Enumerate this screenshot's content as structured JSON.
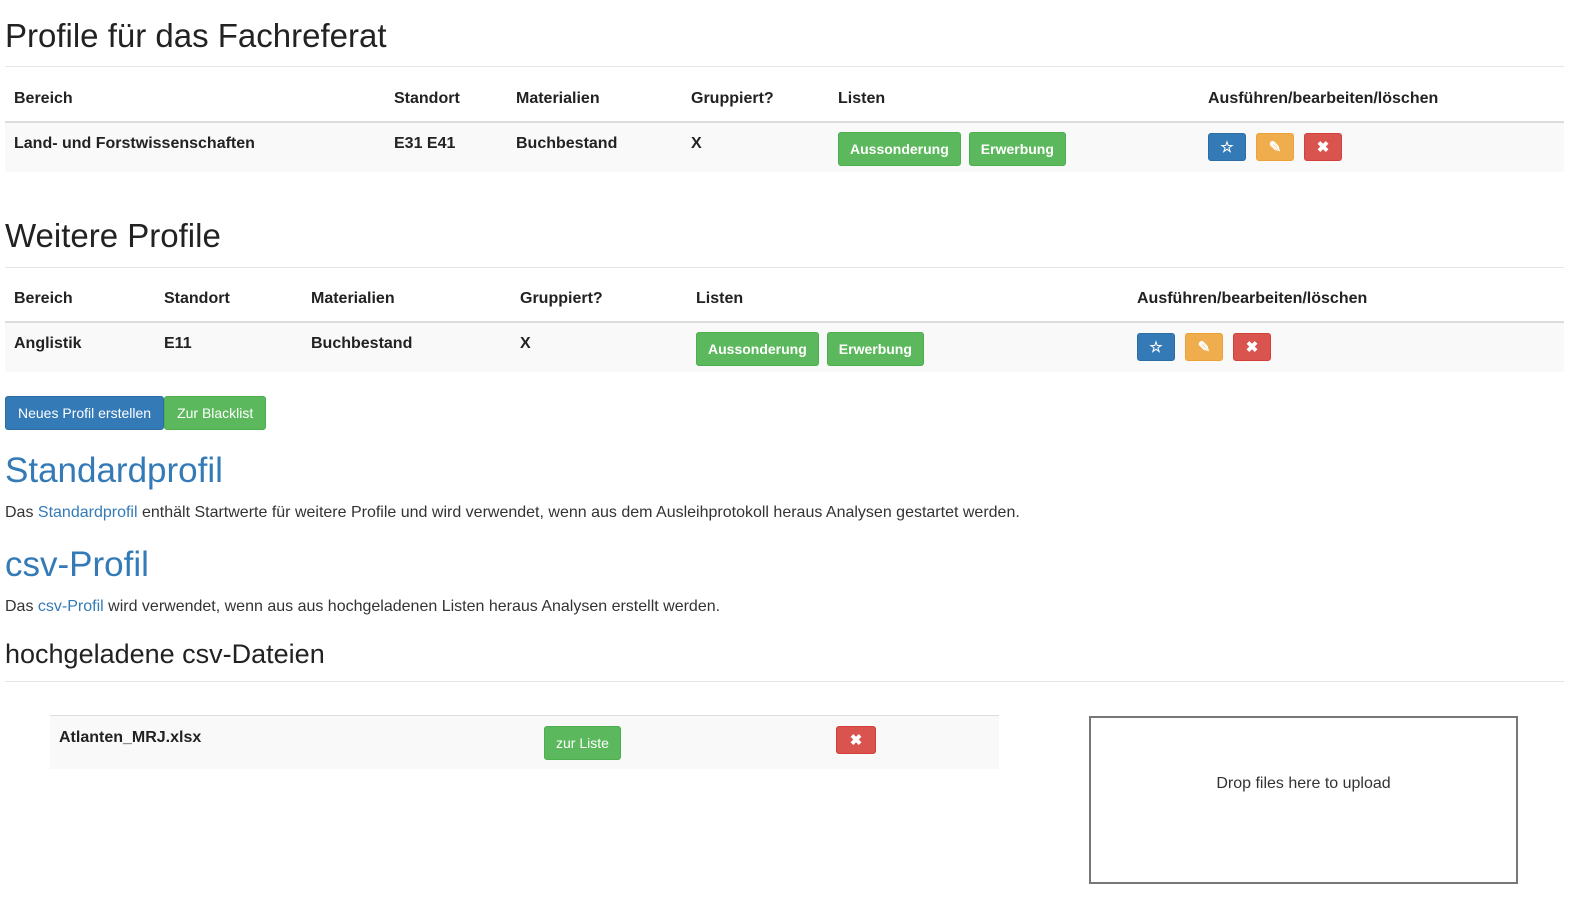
{
  "section1": {
    "title": "Profile für das Fachreferat",
    "headers": [
      "Bereich",
      "Standort",
      "Materialien",
      "Gruppiert?",
      "Listen",
      "Ausführen/bearbeiten/löschen"
    ],
    "row": {
      "bereich": "Land- und Forstwissenschaften",
      "standort": "E31 E41",
      "materialien": "Buchbestand",
      "gruppiert": "X",
      "list_buttons": [
        "Aussonderung",
        "Erwerbung"
      ]
    }
  },
  "section2": {
    "title": "Weitere Profile",
    "headers": [
      "Bereich",
      "Standort",
      "Materialien",
      "Gruppiert?",
      "Listen",
      "Ausführen/bearbeiten/löschen"
    ],
    "row": {
      "bereich": "Anglistik",
      "standort": "E11",
      "materialien": "Buchbestand",
      "gruppiert": "X",
      "list_buttons": [
        "Aussonderung",
        "Erwerbung"
      ]
    }
  },
  "row_actions": {
    "run_icon": "star-icon",
    "edit_icon": "edit-icon",
    "delete_icon": "close-icon"
  },
  "actions": {
    "new_profile": "Neues Profil erstellen",
    "blacklist": "Zur Blacklist"
  },
  "standardprofil": {
    "title": "Standardprofil",
    "desc_prefix": "Das ",
    "desc_link": "Standardprofil",
    "desc_suffix": " enthält Startwerte für weitere Profile und wird verwendet, wenn aus dem Ausleihprotokoll heraus Analysen gestartet werden."
  },
  "csvprofil": {
    "title": "csv-Profil",
    "desc_prefix": "Das ",
    "desc_link": "csv-Profil",
    "desc_suffix": " wird verwendet, wenn aus aus hochgeladenen Listen heraus Analysen erstellt werden."
  },
  "uploads": {
    "title": "hochgeladene csv-Dateien",
    "files": [
      {
        "name": "Atlanten_MRJ.xlsx",
        "list_button": "zur Liste"
      }
    ],
    "dropzone_text": "Drop files here to upload"
  },
  "colors": {
    "primary": "#337ab7",
    "success": "#5cb85c",
    "warning": "#f0ad4e",
    "danger": "#d9534f"
  }
}
